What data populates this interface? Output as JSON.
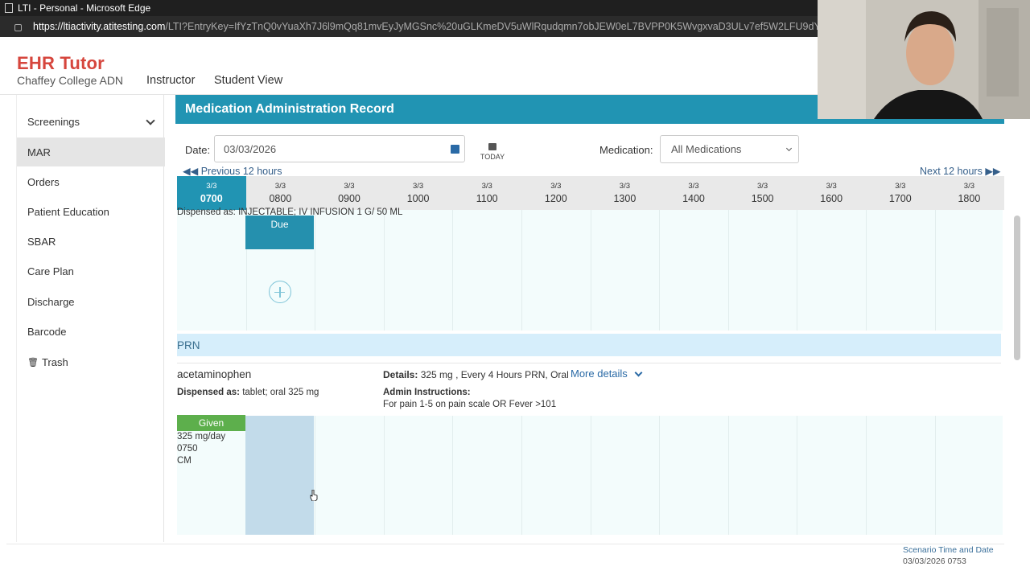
{
  "browser": {
    "window_title": "LTI - Personal - Microsoft Edge",
    "url_host": "https://ltiactivity.atitesting.com",
    "url_path": "/LTI?EntryKey=IfYzTnQ0vYuaXh7J6l9mQq81mvEyJyMGSnc%20uGLKmeDV5uWlRqudqmn7obJEW0eL7BVPP0K5WvgxvaD3ULv7ef5W2LFU9dY4buregiK5"
  },
  "header": {
    "logo": "EHR Tutor",
    "college": "Chaffey College ADN",
    "nav": [
      "Instructor",
      "Student View"
    ]
  },
  "sidebar": {
    "items": [
      {
        "label": "Screenings",
        "expandable": true
      },
      {
        "label": "MAR",
        "active": true
      },
      {
        "label": "Orders"
      },
      {
        "label": "Patient Education"
      },
      {
        "label": "SBAR"
      },
      {
        "label": "Care Plan"
      },
      {
        "label": "Discharge"
      },
      {
        "label": "Barcode"
      },
      {
        "label": "Trash",
        "icon": "trash-icon"
      }
    ]
  },
  "mar": {
    "title": "Medication Administration Record",
    "date_label": "Date:",
    "date_value": "03/03/2026",
    "today_label": "TODAY",
    "medication_label": "Medication:",
    "medication_value": "All Medications",
    "prev_label": "Previous 12 hours",
    "next_label": "Next 12 hours",
    "time_columns": [
      {
        "date": "3/3",
        "time": "0700",
        "current": true
      },
      {
        "date": "3/3",
        "time": "0800"
      },
      {
        "date": "3/3",
        "time": "0900"
      },
      {
        "date": "3/3",
        "time": "1000"
      },
      {
        "date": "3/3",
        "time": "1100"
      },
      {
        "date": "3/3",
        "time": "1200"
      },
      {
        "date": "3/3",
        "time": "1300"
      },
      {
        "date": "3/3",
        "time": "1400"
      },
      {
        "date": "3/3",
        "time": "1500"
      },
      {
        "date": "3/3",
        "time": "1600"
      },
      {
        "date": "3/3",
        "time": "1700"
      },
      {
        "date": "3/3",
        "time": "1800"
      }
    ],
    "scheduled": {
      "dispensed_as": "Dispensed as: INJECTABLE; IV INFUSION 1 G/ 50 ML",
      "status": "Due"
    },
    "prn_section": "PRN",
    "prn_med": {
      "name": "acetaminophen",
      "dispensed_label": "Dispensed as:",
      "dispensed_value": "tablet; oral 325 mg",
      "details_label": "Details:",
      "details_value": "325 mg , Every 4 Hours PRN, Oral",
      "more_details": "More details",
      "admin_label": "Admin Instructions:",
      "admin_text": "For pain 1-5 on pain scale OR Fever >101",
      "given_status": "Given",
      "given_dose": "325 mg/day",
      "given_time": "0750",
      "given_by": "CM"
    }
  },
  "footer": {
    "scenario_label": "Scenario Time and Date",
    "scenario_time": "03/03/2026 0753"
  }
}
